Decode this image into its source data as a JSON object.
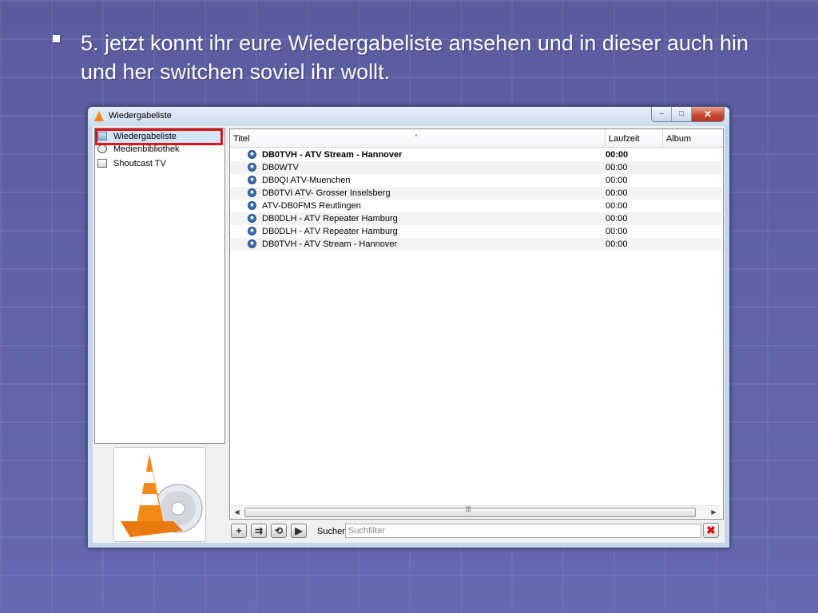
{
  "slide": {
    "bullet_text": "5. jetzt konnt ihr eure Wiedergabeliste ansehen und in dieser auch hin und her switchen soviel ihr wollt."
  },
  "window": {
    "title": "Wiedergabeliste",
    "controls": {
      "minimize": "–",
      "maximize": "□",
      "close": "✕"
    }
  },
  "sidebar": {
    "items": [
      {
        "label": "Wiedergabeliste",
        "icon": "folder-icon",
        "selected": true
      },
      {
        "label": "Medienbibliothek",
        "icon": "disc-icon"
      },
      {
        "label": "Shoutcast TV",
        "icon": "box-icon"
      }
    ]
  },
  "playlist": {
    "columns": {
      "title": "Titel",
      "duration": "Laufzeit",
      "album": "Album"
    },
    "rows": [
      {
        "title": "DB0TVH - ATV Stream - Hannover",
        "duration": "00:00",
        "playing": true
      },
      {
        "title": "DB0WTV",
        "duration": "00:00"
      },
      {
        "title": "DB0QI ATV-Muenchen",
        "duration": "00:00"
      },
      {
        "title": "DB0TVI ATV- Grosser Inselsberg",
        "duration": "00:00"
      },
      {
        "title": "ATV-DB0FMS Reutlingen",
        "duration": "00:00"
      },
      {
        "title": "DB0DLH - ATV Repeater Hamburg",
        "duration": "00:00"
      },
      {
        "title": "DB0DLH - ATV Repeater Hamburg",
        "duration": "00:00"
      },
      {
        "title": "DB0TVH - ATV Stream - Hannover",
        "duration": "00:00"
      }
    ]
  },
  "bottom_bar": {
    "add": "+",
    "shuffle": "⇉",
    "repeat": "⟲",
    "play_selected": "▶",
    "search_label": "Suchen",
    "search_placeholder": "Suchfilter",
    "clear": "✖"
  },
  "colors": {
    "accent_highlight": "#e0141c",
    "selection": "#cfe6fb",
    "vlc_orange": "#f28a16"
  }
}
